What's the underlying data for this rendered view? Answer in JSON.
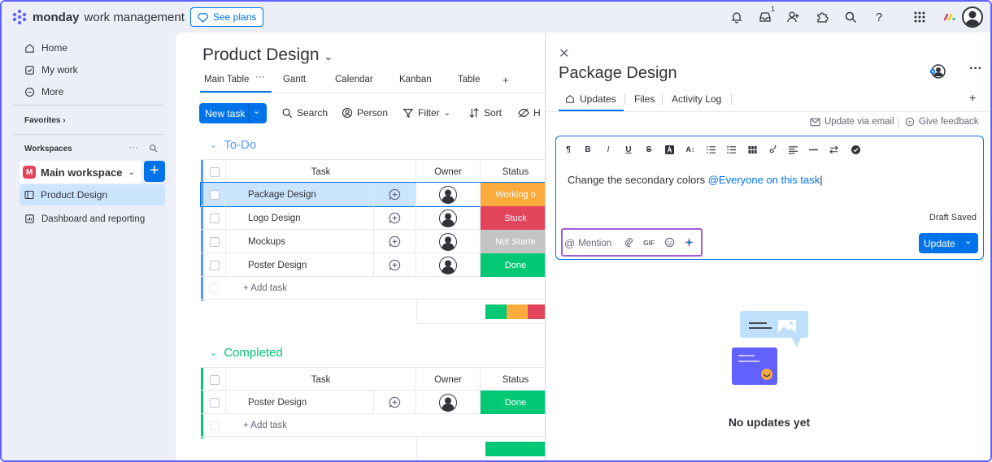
{
  "topbar": {
    "brand_bold": "monday",
    "brand_rest": "work management",
    "see_plans": "See plans",
    "inbox_count": "1",
    "icons": [
      "bell-icon",
      "inbox-icon",
      "invite-icon",
      "apps-icon",
      "search-icon",
      "help-icon",
      "grid-icon",
      "monday-logo",
      "avatar"
    ]
  },
  "sidebar": {
    "home": "Home",
    "my_work": "My work",
    "more": "More",
    "favorites": "Favorites",
    "workspaces": "Workspaces",
    "workspace_initial": "M",
    "workspace_name": "Main workspace",
    "items": [
      {
        "label": "Product Design"
      },
      {
        "label": "Dashboard and reporting"
      }
    ]
  },
  "board": {
    "title": "Product Design",
    "tabs": [
      {
        "label": "Main Table"
      },
      {
        "label": "Gantt"
      },
      {
        "label": "Calendar"
      },
      {
        "label": "Kanban"
      },
      {
        "label": "Table"
      },
      {
        "label": "+"
      }
    ],
    "new_task": "New task",
    "tools": {
      "search": "Search",
      "person": "Person",
      "filter": "Filter",
      "sort": "Sort",
      "hide": "H"
    },
    "columns": {
      "task": "Task",
      "owner": "Owner",
      "status": "Status"
    },
    "add_task": "+ Add task",
    "groups": [
      {
        "name": "To-Do",
        "color": "#579bfc",
        "rows": [
          {
            "task": "Package Design",
            "status": "Working o",
            "color": "#fdab3d"
          },
          {
            "task": "Logo Design",
            "status": "Stuck",
            "color": "#e2445c"
          },
          {
            "task": "Mockups",
            "status": "Not Starte",
            "color": "#c4c4c4"
          },
          {
            "task": "Poster Design",
            "status": "Done",
            "color": "#00c875"
          }
        ]
      },
      {
        "name": "Completed",
        "color": "#00c875",
        "rows": [
          {
            "task": "Poster Design",
            "status": "Done",
            "color": "#00c875"
          }
        ]
      }
    ]
  },
  "panel": {
    "title": "Package Design",
    "tabs": [
      {
        "label": "Updates"
      },
      {
        "label": "Files"
      },
      {
        "label": "Activity Log"
      },
      {
        "label": "+"
      }
    ],
    "update_via_email": "Update via email",
    "give_feedback": "Give feedback",
    "editor_text": "Change the secondary colors ",
    "mention_text": "@Everyone on this task",
    "draft_saved": "Draft Saved",
    "mention_label": "Mention",
    "gif": "GIF",
    "update_button": "Update",
    "no_updates": "No updates yet"
  }
}
